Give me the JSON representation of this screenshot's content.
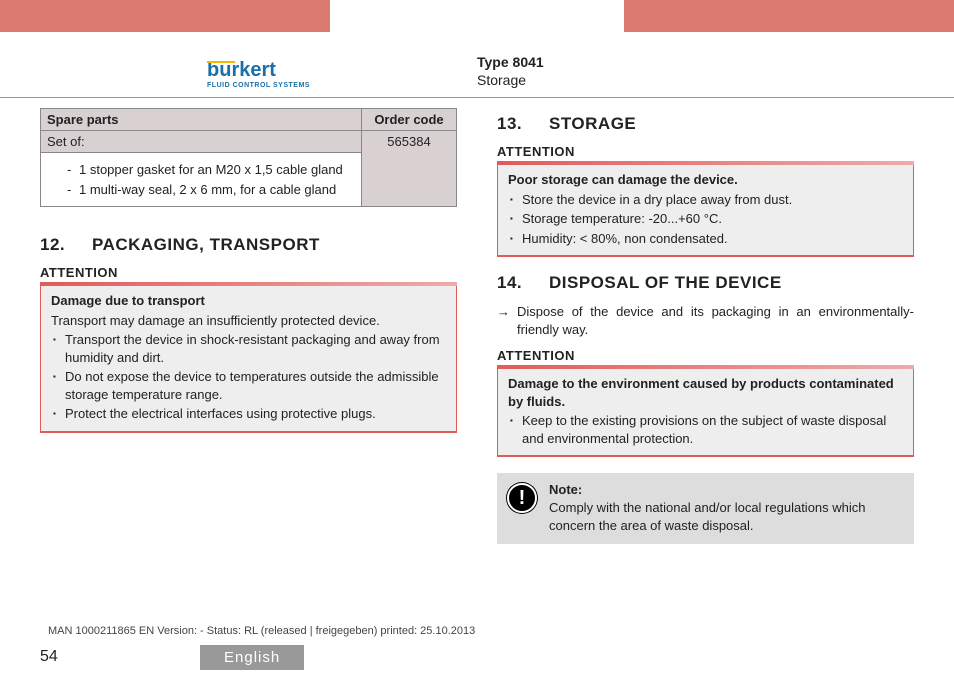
{
  "header": {
    "logo_text": "burkert",
    "logo_sub": "FLUID CONTROL SYSTEMS",
    "doc_type": "Type 8041",
    "doc_section": "Storage"
  },
  "spare_table": {
    "col1": "Spare parts",
    "col2": "Order code",
    "set_label": "Set of:",
    "set_code": "565384",
    "item1": "1 stopper gasket for an M20 x 1,5 cable gland",
    "item2": "1 multi-way seal, 2 x 6 mm, for a cable gland"
  },
  "s12": {
    "num": "12.",
    "title": "PACKAGING, TRANSPORT",
    "attention_label": "ATTENTION",
    "attn_title": "Damage due to transport",
    "attn_intro": "Transport may damage an insufficiently protected device.",
    "b1": "Transport the device in shock-resistant packaging and away from humidity and dirt.",
    "b2": "Do not expose the device to temperatures outside the admissible storage temperature range.",
    "b3": "Protect the electrical interfaces using protective plugs."
  },
  "s13": {
    "num": "13.",
    "title": "STORAGE",
    "attention_label": "ATTENTION",
    "attn_title": "Poor storage can damage the device.",
    "b1": "Store the device in a dry place away from dust.",
    "b2": "Storage temperature: -20...+60 °C.",
    "b3": "Humidity: < 80%, non condensated."
  },
  "s14": {
    "num": "14.",
    "title": "DISPOSAL OF THE DEVICE",
    "arrow": "Dispose of the device and its packaging in an environmentally-friendly way.",
    "attention_label": "ATTENTION",
    "attn_title": "Damage to the environment caused by products contaminated by fluids.",
    "b1": "Keep to the existing provisions on the subject of waste disposal and environmental protection.",
    "note_title": "Note:",
    "note_body": "Comply with the national and/or local regulations which concern the area of waste disposal."
  },
  "footer": {
    "meta": "MAN 1000211865 EN Version: - Status: RL (released | freigegeben) printed: 25.10.2013",
    "page": "54",
    "lang": "English"
  }
}
